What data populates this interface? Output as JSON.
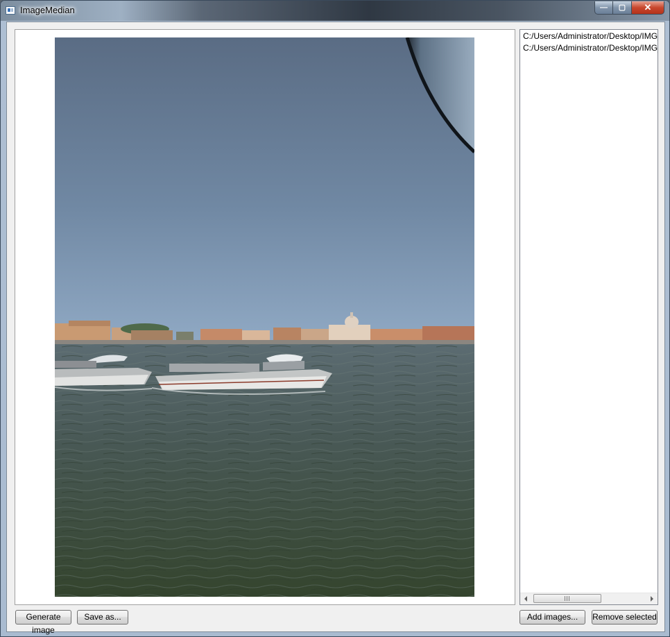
{
  "window": {
    "title": "ImageMedian",
    "min_glyph": "—",
    "max_glyph": "▢",
    "close_glyph": "✕"
  },
  "file_list": {
    "items": [
      "C:/Users/Administrator/Desktop/IMG_",
      "C:/Users/Administrator/Desktop/IMG_"
    ]
  },
  "buttons": {
    "generate": "Generate image",
    "save_as": "Save as...",
    "add_images": "Add images...",
    "remove_selected": "Remove selected"
  },
  "icons": {
    "app": "app-window-icon",
    "scroll_left": "chevron-left-icon",
    "scroll_right": "chevron-right-icon"
  }
}
